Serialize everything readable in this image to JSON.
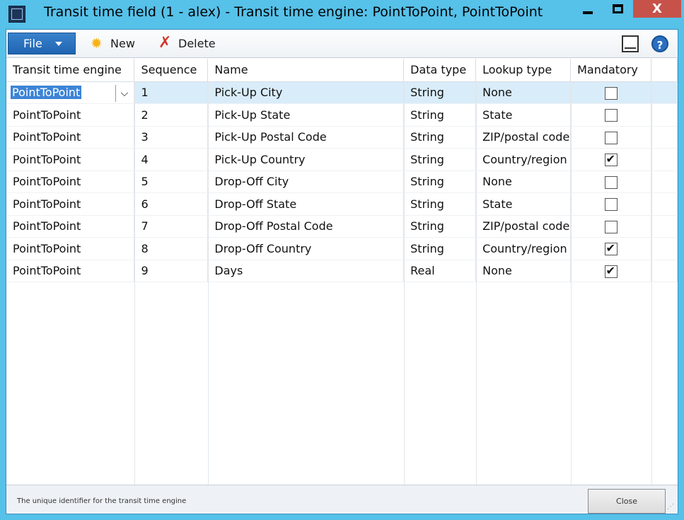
{
  "window": {
    "title": "Transit time field (1 - alex) - Transit time engine: PointToPoint, PointToPoint",
    "app_icon_glyph": "卯"
  },
  "toolbar": {
    "file_label": "File",
    "new_label": "New",
    "delete_label": "Delete"
  },
  "grid": {
    "columns": [
      "Transit time engine",
      "Sequence",
      "Name",
      "Data type",
      "Lookup type",
      "Mandatory"
    ],
    "rows": [
      {
        "engine": "PointToPoint",
        "sequence": "1",
        "name": "Pick-Up City",
        "data_type": "String",
        "lookup_type": "None",
        "mandatory": false
      },
      {
        "engine": "PointToPoint",
        "sequence": "2",
        "name": "Pick-Up State",
        "data_type": "String",
        "lookup_type": "State",
        "mandatory": false
      },
      {
        "engine": "PointToPoint",
        "sequence": "3",
        "name": "Pick-Up Postal Code",
        "data_type": "String",
        "lookup_type": "ZIP/postal code",
        "mandatory": false
      },
      {
        "engine": "PointToPoint",
        "sequence": "4",
        "name": "Pick-Up Country",
        "data_type": "String",
        "lookup_type": "Country/region",
        "mandatory": true
      },
      {
        "engine": "PointToPoint",
        "sequence": "5",
        "name": "Drop-Off City",
        "data_type": "String",
        "lookup_type": "None",
        "mandatory": false
      },
      {
        "engine": "PointToPoint",
        "sequence": "6",
        "name": "Drop-Off State",
        "data_type": "String",
        "lookup_type": "State",
        "mandatory": false
      },
      {
        "engine": "PointToPoint",
        "sequence": "7",
        "name": "Drop-Off Postal Code",
        "data_type": "String",
        "lookup_type": "ZIP/postal code",
        "mandatory": false
      },
      {
        "engine": "PointToPoint",
        "sequence": "8",
        "name": "Drop-Off Country",
        "data_type": "String",
        "lookup_type": "Country/region",
        "mandatory": true
      },
      {
        "engine": "PointToPoint",
        "sequence": "9",
        "name": "Days",
        "data_type": "Real",
        "lookup_type": "None",
        "mandatory": true
      }
    ]
  },
  "status": {
    "help_text": "The unique identifier for the transit time engine",
    "close_label": "Close"
  },
  "colors": {
    "title_bar": "#56c1e9",
    "file_button": "#1f64b1",
    "selected_row": "#d9ecf9",
    "close_button_accent": "#c7524a"
  }
}
